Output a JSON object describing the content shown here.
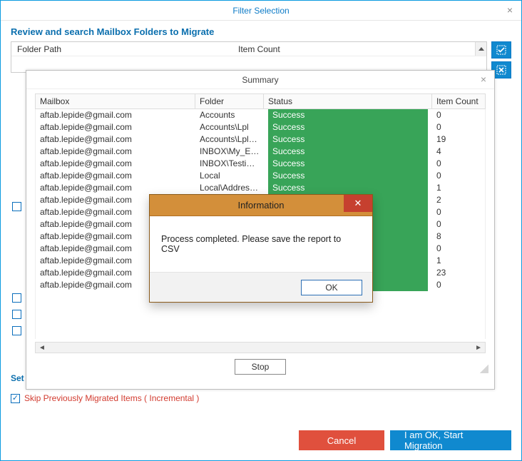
{
  "outer": {
    "title": "Filter Selection",
    "subtitle": "Review and search Mailbox Folders to Migrate",
    "columns": {
      "folder": "Folder Path",
      "item": "Item Count"
    },
    "set_label": "Set",
    "skip_label": "Skip Previously Migrated Items ( Incremental )",
    "buttons": {
      "cancel": "Cancel",
      "start": "I am OK, Start Migration"
    }
  },
  "summary": {
    "title": "Summary",
    "columns": {
      "mailbox": "Mailbox",
      "folder": "Folder",
      "status": "Status",
      "count": "Item Count"
    },
    "stop": "Stop",
    "rows": [
      {
        "mailbox": "aftab.lepide@gmail.com",
        "folder": "Accounts",
        "status": "Success",
        "count": 0
      },
      {
        "mailbox": "aftab.lepide@gmail.com",
        "folder": "Accounts\\Lpl",
        "status": "Success",
        "count": 0
      },
      {
        "mailbox": "aftab.lepide@gmail.com",
        "folder": "Accounts\\Lpl\\N...",
        "status": "Success",
        "count": 19
      },
      {
        "mailbox": "aftab.lepide@gmail.com",
        "folder": "INBOX\\My_Emails",
        "status": "Success",
        "count": 4
      },
      {
        "mailbox": "aftab.lepide@gmail.com",
        "folder": "INBOX\\Testing M",
        "status": "Success",
        "count": 0
      },
      {
        "mailbox": "aftab.lepide@gmail.com",
        "folder": "Local",
        "status": "Success",
        "count": 0
      },
      {
        "mailbox": "aftab.lepide@gmail.com",
        "folder": "Local\\Address B...",
        "status": "Success",
        "count": 1
      },
      {
        "mailbox": "aftab.lepide@gmail.com",
        "folder": "",
        "status": "",
        "count": 2
      },
      {
        "mailbox": "aftab.lepide@gmail.com",
        "folder": "",
        "status": "",
        "count": 0
      },
      {
        "mailbox": "aftab.lepide@gmail.com",
        "folder": "",
        "status": "",
        "count": 0
      },
      {
        "mailbox": "aftab.lepide@gmail.com",
        "folder": "",
        "status": "",
        "count": 8
      },
      {
        "mailbox": "aftab.lepide@gmail.com",
        "folder": "",
        "status": "",
        "count": 0
      },
      {
        "mailbox": "aftab.lepide@gmail.com",
        "folder": "",
        "status": "",
        "count": 1
      },
      {
        "mailbox": "aftab.lepide@gmail.com",
        "folder": "",
        "status": "",
        "count": 23
      },
      {
        "mailbox": "aftab.lepide@gmail.com",
        "folder": "",
        "status": "",
        "count": 0
      }
    ]
  },
  "info": {
    "title": "Information",
    "message": "Process completed. Please save the report to CSV",
    "ok": "OK"
  }
}
